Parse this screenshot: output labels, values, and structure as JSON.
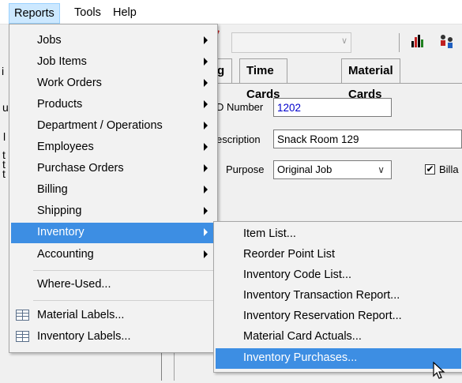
{
  "menubar": {
    "items": [
      "Reports",
      "Tools",
      "Help"
    ]
  },
  "background": {
    "tabs": [
      "g",
      "Time Cards",
      "Material Cards"
    ],
    "fields": {
      "number_label": "D Number",
      "number_value": "1202",
      "description_label": "escription",
      "description_value": "Snack Room 129",
      "purpose_label": "Purpose",
      "purpose_value": "Original Job",
      "billable_label": "Billa"
    },
    "stray_chars": [
      "i",
      "u",
      "l",
      "t",
      "t",
      "t"
    ],
    "toolbar_icons": [
      "bar-chart-icon",
      "people-icon"
    ]
  },
  "reports_menu": {
    "items": [
      {
        "label": "Jobs",
        "submenu": true
      },
      {
        "label": "Job Items",
        "submenu": true
      },
      {
        "label": "Work Orders",
        "submenu": true
      },
      {
        "label": "Products",
        "submenu": true
      },
      {
        "label": "Department / Operations",
        "submenu": true
      },
      {
        "label": "Employees",
        "submenu": true
      },
      {
        "label": "Purchase Orders",
        "submenu": true
      },
      {
        "label": "Billing",
        "submenu": true
      },
      {
        "label": "Shipping",
        "submenu": true
      },
      {
        "label": "Inventory",
        "submenu": true,
        "highlighted": true
      },
      {
        "label": "Accounting",
        "submenu": true
      }
    ],
    "where_used": "Where-Used...",
    "material_labels": "Material Labels...",
    "inventory_labels": "Inventory Labels..."
  },
  "inventory_submenu": {
    "items": [
      "Item List...",
      "Reorder Point List",
      "Inventory Code List...",
      "Inventory Transaction Report...",
      "Inventory Reservation Report...",
      "Material Card Actuals...",
      "Inventory Purchases..."
    ],
    "hovered": "Inventory Purchases..."
  },
  "colors": {
    "highlight": "#3d8ee3",
    "menubar_active": "#cce8ff",
    "link_blue": "#0000cc"
  }
}
